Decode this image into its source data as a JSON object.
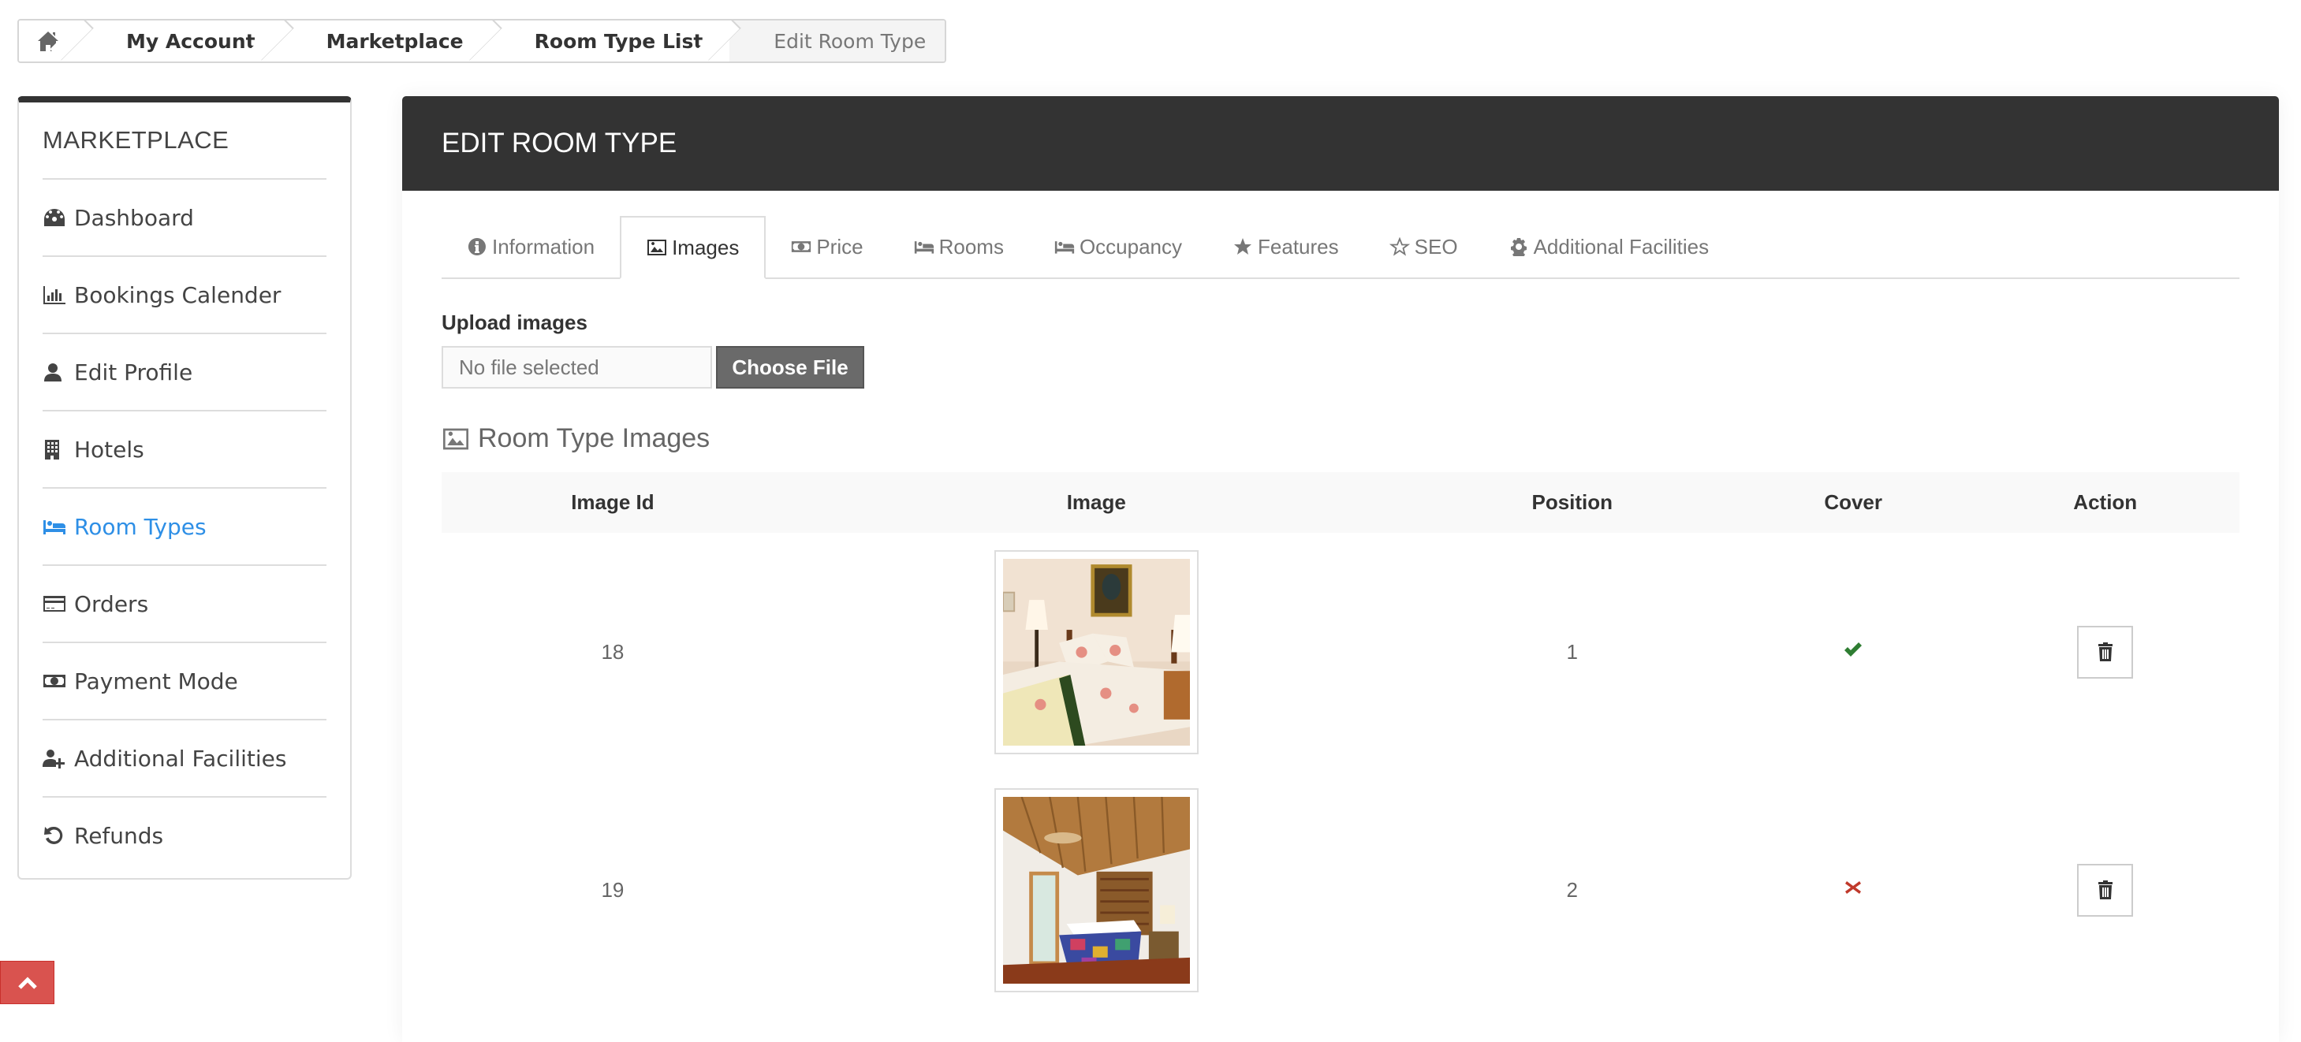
{
  "breadcrumb": {
    "home_icon": "home-icon",
    "items": [
      "My Account",
      "Marketplace",
      "Room Type List"
    ],
    "current": "Edit Room Type"
  },
  "sidebar": {
    "title": "MARKETPLACE",
    "items": [
      {
        "label": "Dashboard",
        "icon": "dashboard-icon",
        "active": false
      },
      {
        "label": "Bookings Calender",
        "icon": "bar-chart-icon",
        "active": false
      },
      {
        "label": "Edit Profile",
        "icon": "user-icon",
        "active": false
      },
      {
        "label": "Hotels",
        "icon": "building-icon",
        "active": false
      },
      {
        "label": "Room Types",
        "icon": "bed-icon",
        "active": true
      },
      {
        "label": "Orders",
        "icon": "credit-card-icon",
        "active": false
      },
      {
        "label": "Payment Mode",
        "icon": "money-icon",
        "active": false
      },
      {
        "label": "Additional Facilities",
        "icon": "user-plus-icon",
        "active": false
      },
      {
        "label": "Refunds",
        "icon": "undo-icon",
        "active": false
      }
    ],
    "active_color": "#2e8fe6"
  },
  "panel": {
    "title": "EDIT ROOM TYPE",
    "tabs": [
      {
        "label": "Information",
        "icon": "info-circle-icon",
        "active": false
      },
      {
        "label": "Images",
        "icon": "image-icon",
        "active": true
      },
      {
        "label": "Price",
        "icon": "money-icon",
        "active": false
      },
      {
        "label": "Rooms",
        "icon": "bed-icon",
        "active": false
      },
      {
        "label": "Occupancy",
        "icon": "bed-icon",
        "active": false
      },
      {
        "label": "Features",
        "icon": "star-icon",
        "active": false
      },
      {
        "label": "SEO",
        "icon": "star-outline-icon",
        "active": false
      },
      {
        "label": "Additional Facilities",
        "icon": "gear-icon",
        "active": false
      }
    ]
  },
  "upload": {
    "label": "Upload images",
    "file_status": "No file selected",
    "button_label": "Choose File"
  },
  "images_section": {
    "title": "Room Type Images",
    "columns": [
      "Image Id",
      "Image",
      "Position",
      "Cover",
      "Action"
    ],
    "rows": [
      {
        "id": "18",
        "image": "bedroom-floral-quilt-thumbnail",
        "position": "1",
        "cover": true,
        "action_icon": "trash-icon"
      },
      {
        "id": "19",
        "image": "bedroom-wood-ceiling-thumbnail",
        "position": "2",
        "cover": false,
        "action_icon": "trash-icon"
      }
    ]
  },
  "colors": {
    "header_bg": "#333333",
    "cover_yes": "#2e7d32",
    "cover_no": "#c0392b",
    "scroll_top": "#d9534f"
  }
}
